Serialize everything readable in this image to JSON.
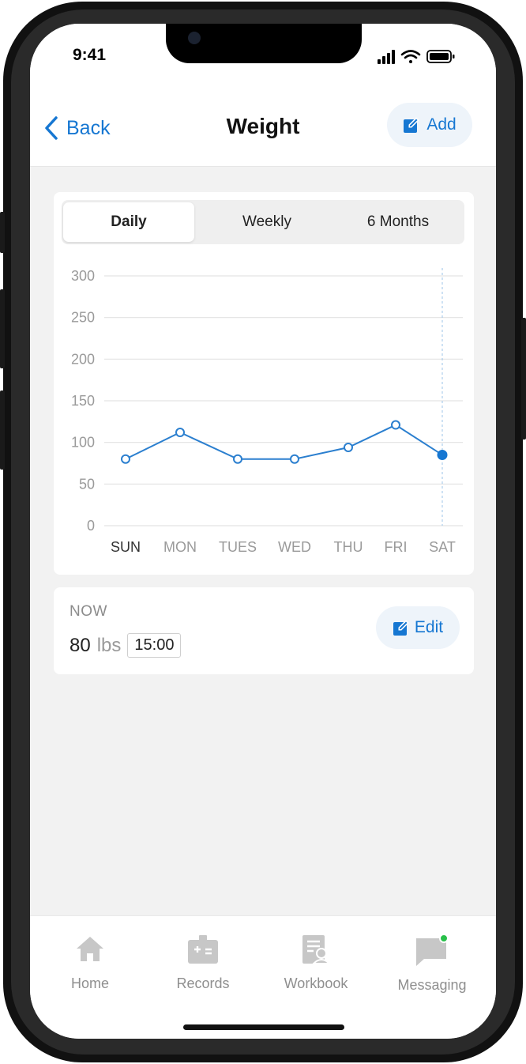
{
  "status": {
    "time": "9:41"
  },
  "header": {
    "back_label": "Back",
    "title": "Weight",
    "add_label": "Add"
  },
  "segments": [
    "Daily",
    "Weekly",
    "6 Months"
  ],
  "chart_data": {
    "type": "line",
    "categories": [
      "SUN",
      "MON",
      "TUES",
      "WED",
      "THU",
      "FRI",
      "SAT"
    ],
    "series": [
      {
        "values": [
          80,
          112,
          80,
          80,
          94,
          121,
          85
        ]
      }
    ],
    "yticks": [
      300,
      250,
      200,
      150,
      100,
      50,
      0
    ],
    "ylim": [
      0,
      300
    ],
    "grid": true,
    "highlight_category": "SAT",
    "colors": {
      "line": "#2b7fcf",
      "selected_point": "#1677d2"
    }
  },
  "now": {
    "label": "NOW",
    "value": "80",
    "unit": "lbs",
    "time": "15:00",
    "edit_label": "Edit"
  },
  "tabs": [
    {
      "label": "Home",
      "icon": "home-icon"
    },
    {
      "label": "Records",
      "icon": "records-icon"
    },
    {
      "label": "Workbook",
      "icon": "workbook-icon"
    },
    {
      "label": "Messaging",
      "icon": "messaging-icon",
      "badge": true
    }
  ],
  "colors": {
    "accent": "#1677d2",
    "badge": "#28c04a"
  }
}
